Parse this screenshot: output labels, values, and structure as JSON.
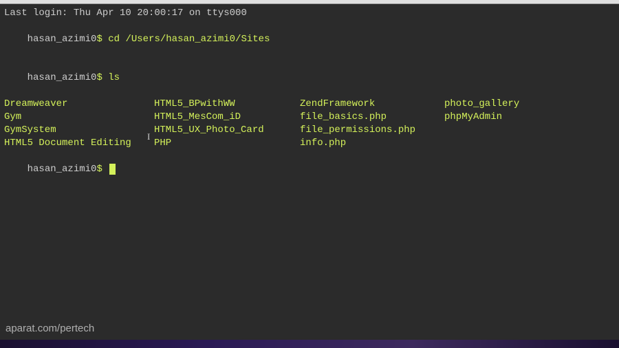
{
  "header": {
    "last_login": "Last login: Thu Apr 10 20:00:17 on ttys000"
  },
  "prompts": {
    "user_host": "hasan_azimi0",
    "dollar": "$",
    "cmd_cd": "cd /Users/hasan_azimi0/Sites",
    "cmd_ls": "ls"
  },
  "ls": {
    "r1c1": "Dreamweaver",
    "r1c2": "HTML5_BPwithWW",
    "r1c3": "ZendFramework",
    "r1c4": "photo_gallery",
    "r2c1": "Gym",
    "r2c2": "HTML5_MesCom_iD",
    "r2c3": "file_basics.php",
    "r2c4": "phpMyAdmin",
    "r3c1": "GymSystem",
    "r3c2": "HTML5_UX_Photo_Card",
    "r3c3": "file_permissions.php",
    "r3c4": "",
    "r4c1": "HTML5 Document Editing",
    "r4c2": "PHP",
    "r4c3": "info.php",
    "r4c4": ""
  },
  "watermark": "aparat.com/pertech"
}
